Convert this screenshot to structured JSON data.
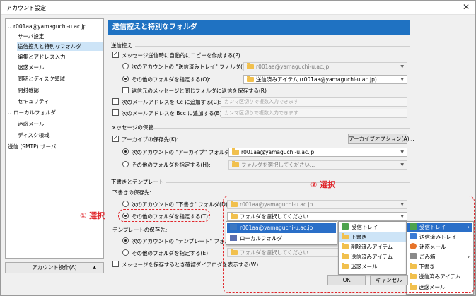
{
  "window": {
    "title": "アカウント設定",
    "close": "✕"
  },
  "tree": {
    "items": [
      {
        "label": "r001aa@yamaguchi-u.ac.jp",
        "level": 0,
        "twisty": "⌄"
      },
      {
        "label": "サーバ設定",
        "level": 1
      },
      {
        "label": "送信控えと特別なフォルダ",
        "level": 1,
        "selected": true
      },
      {
        "label": "編集とアドレス入力",
        "level": 1
      },
      {
        "label": "迷惑メール",
        "level": 1
      },
      {
        "label": "同期とディスク領域",
        "level": 1
      },
      {
        "label": "開封確認",
        "level": 1
      },
      {
        "label": "セキュリティ",
        "level": 1
      },
      {
        "label": "ローカルフォルダ",
        "level": 0,
        "twisty": "⌄"
      },
      {
        "label": "迷惑メール",
        "level": 1
      },
      {
        "label": "ディスク領域",
        "level": 1
      },
      {
        "label": "送信 (SMTP) サーバ",
        "level": 0
      }
    ],
    "account_actions": "アカウント操作(A)"
  },
  "panel": {
    "header": "送信控えと特別なフォルダ",
    "sent": {
      "group": "送信控え",
      "auto_copy": "メッセージ送信時に自動的にコピーを作成する(P)",
      "other_account_sent": "次のアカウントの \"送信済みトレイ\" フォルダ(S):",
      "other_account_sent_value": "r001aa@yamaguchi-u.ac.jp",
      "other_folder": "その他のフォルダを指定する(O):",
      "other_folder_value": "送信済みアイテム (r001aa@yamaguchi-u.ac.jp)",
      "reply_same": "返信元のメッセージと同じフォルダに返信を保存する(R)",
      "cc": "次のメールアドレスを Cc に追加する(C):",
      "bcc": "次のメールアドレスを Bcc に追加する(B):",
      "cc_placeholder": "カンマ区切りで複数入力できます",
      "bcc_placeholder": "カンマ区切りで複数入力できます"
    },
    "archive": {
      "group": "メッセージの保管",
      "dest": "アーカイブの保存先(K):",
      "options_button": "アーカイブオプション(A)...",
      "other_account": "次のアカウントの \"アーカイブ\" フォルダ(N):",
      "other_account_value": "r001aa@yamaguchi-u.ac.jp",
      "other_folder": "その他のフォルダを指定する(H):",
      "other_folder_value": "フォルダを選択してください..."
    },
    "drafts": {
      "group": "下書きとテンプレート",
      "drafts_dest": "下書きの保存先:",
      "drafts_account": "次のアカウントの \"下書き\" フォルダ(D):",
      "drafts_account_value": "r001aa@yamaguchi-u.ac.jp",
      "drafts_other": "その他のフォルダを指定する(T):",
      "drafts_other_value": "フォルダを選択してください...",
      "templates_dest": "テンプレートの保存先:",
      "templates_account": "次のアカウントの \"テンプレート\" フォルダ(E):",
      "templates_other": "その他のフォルダを指定する(E):",
      "templates_other_value": "フォルダを選択してください...",
      "confirm": "メッセージを保存するとき確認ダイアログを表示する(W)"
    }
  },
  "popup_accounts": {
    "items": [
      "r001aa@yamaguchi-u.ac.jp",
      "ローカルフォルダ"
    ]
  },
  "popup_account_folders": {
    "items": [
      "受信トレイ",
      "下書き",
      "削除済みアイテム",
      "送信済みアイテム",
      "迷惑メール"
    ]
  },
  "popup_local_folders": {
    "items": [
      "受信トレイ",
      "送信済みトレイ",
      "迷惑メール",
      "ごみ箱",
      "下書き",
      "送信済みアイテム",
      "迷惑メール"
    ]
  },
  "buttons": {
    "ok": "OK",
    "cancel": "キャンセル"
  },
  "annotations": {
    "step1": "① 選択",
    "step2": "② 選択"
  },
  "colors": {
    "accent": "#1f72c2",
    "annotation": "#e0262b"
  }
}
